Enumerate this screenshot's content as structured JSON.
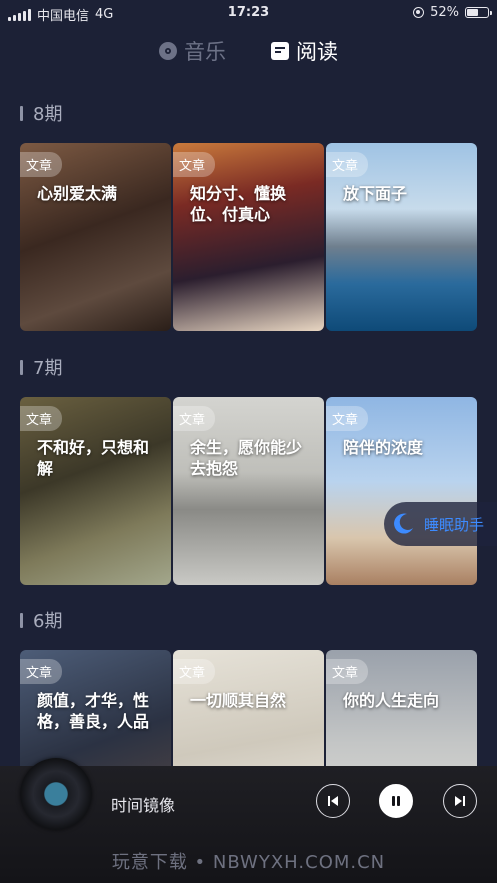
{
  "status": {
    "carrier": "中国电信",
    "network": "4G",
    "time": "17:23",
    "battery": "52%",
    "battery_level": 0.52
  },
  "tabs": [
    {
      "label": "音乐",
      "icon": "music-disc-icon"
    },
    {
      "label": "阅读",
      "icon": "reading-icon"
    }
  ],
  "sections": [
    {
      "title": "8期",
      "cards": [
        {
          "tag": "文章",
          "title": "心别爱太满"
        },
        {
          "tag": "文章",
          "title": "知分寸、懂换位、付真心"
        },
        {
          "tag": "文章",
          "title": "放下面子"
        }
      ]
    },
    {
      "title": "7期",
      "cards": [
        {
          "tag": "文章",
          "title": "不和好，只想和解"
        },
        {
          "tag": "文章",
          "title": "余生，愿你能少去抱怨"
        },
        {
          "tag": "文章",
          "title": "陪伴的浓度"
        }
      ]
    },
    {
      "title": "6期",
      "cards": [
        {
          "tag": "文章",
          "title": "颜值，才华，性格，善良，人品"
        },
        {
          "tag": "文章",
          "title": "一切顺其自然"
        },
        {
          "tag": "文章",
          "title": "你的人生走向"
        }
      ]
    }
  ],
  "sleep_assistant": {
    "label": "睡眠助手",
    "icon": "moon-icon"
  },
  "player": {
    "song": "时间镜像"
  },
  "watermark": "玩意下载 • NBWYXH.COM.CN",
  "colors": {
    "background": "#1c2136",
    "accent": "#3d8bff"
  }
}
